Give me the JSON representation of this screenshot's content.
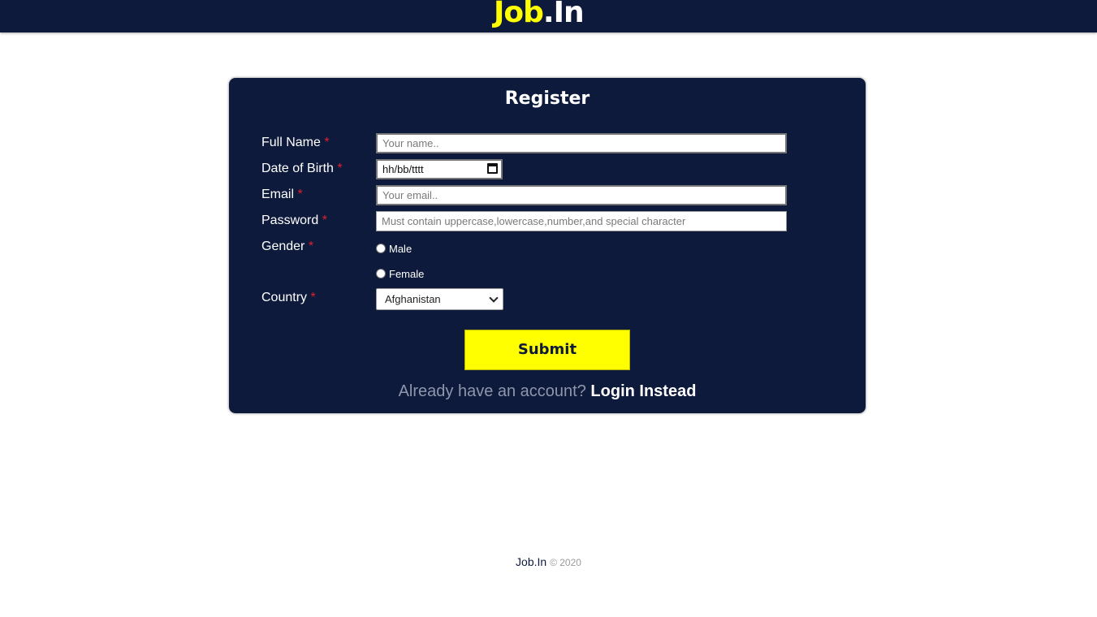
{
  "header": {
    "logo_job": "Job",
    "logo_in": ".In"
  },
  "form": {
    "title": "Register",
    "required_mark": "*",
    "full_name": {
      "label": "Full Name",
      "placeholder": "Your name.."
    },
    "dob": {
      "label": "Date of Birth",
      "value": "hh/bb/tttt",
      "icon": "calendar-icon"
    },
    "email": {
      "label": "Email",
      "placeholder": "Your email.."
    },
    "password": {
      "label": "Password",
      "placeholder": "Must contain uppercase,lowercase,number,and special character"
    },
    "gender": {
      "label": "Gender",
      "options": [
        "Male",
        "Female"
      ]
    },
    "country": {
      "label": "Country",
      "selected": "Afghanistan"
    },
    "submit_label": "Submit",
    "login_prompt": "Already have an account?",
    "login_link": "Login Instead"
  },
  "footer": {
    "brand": "Job.In",
    "copyright": "© 2020"
  },
  "colors": {
    "navy": "#0d1a3b",
    "accent_yellow": "#ffff00",
    "required_red": "#e0202e"
  }
}
